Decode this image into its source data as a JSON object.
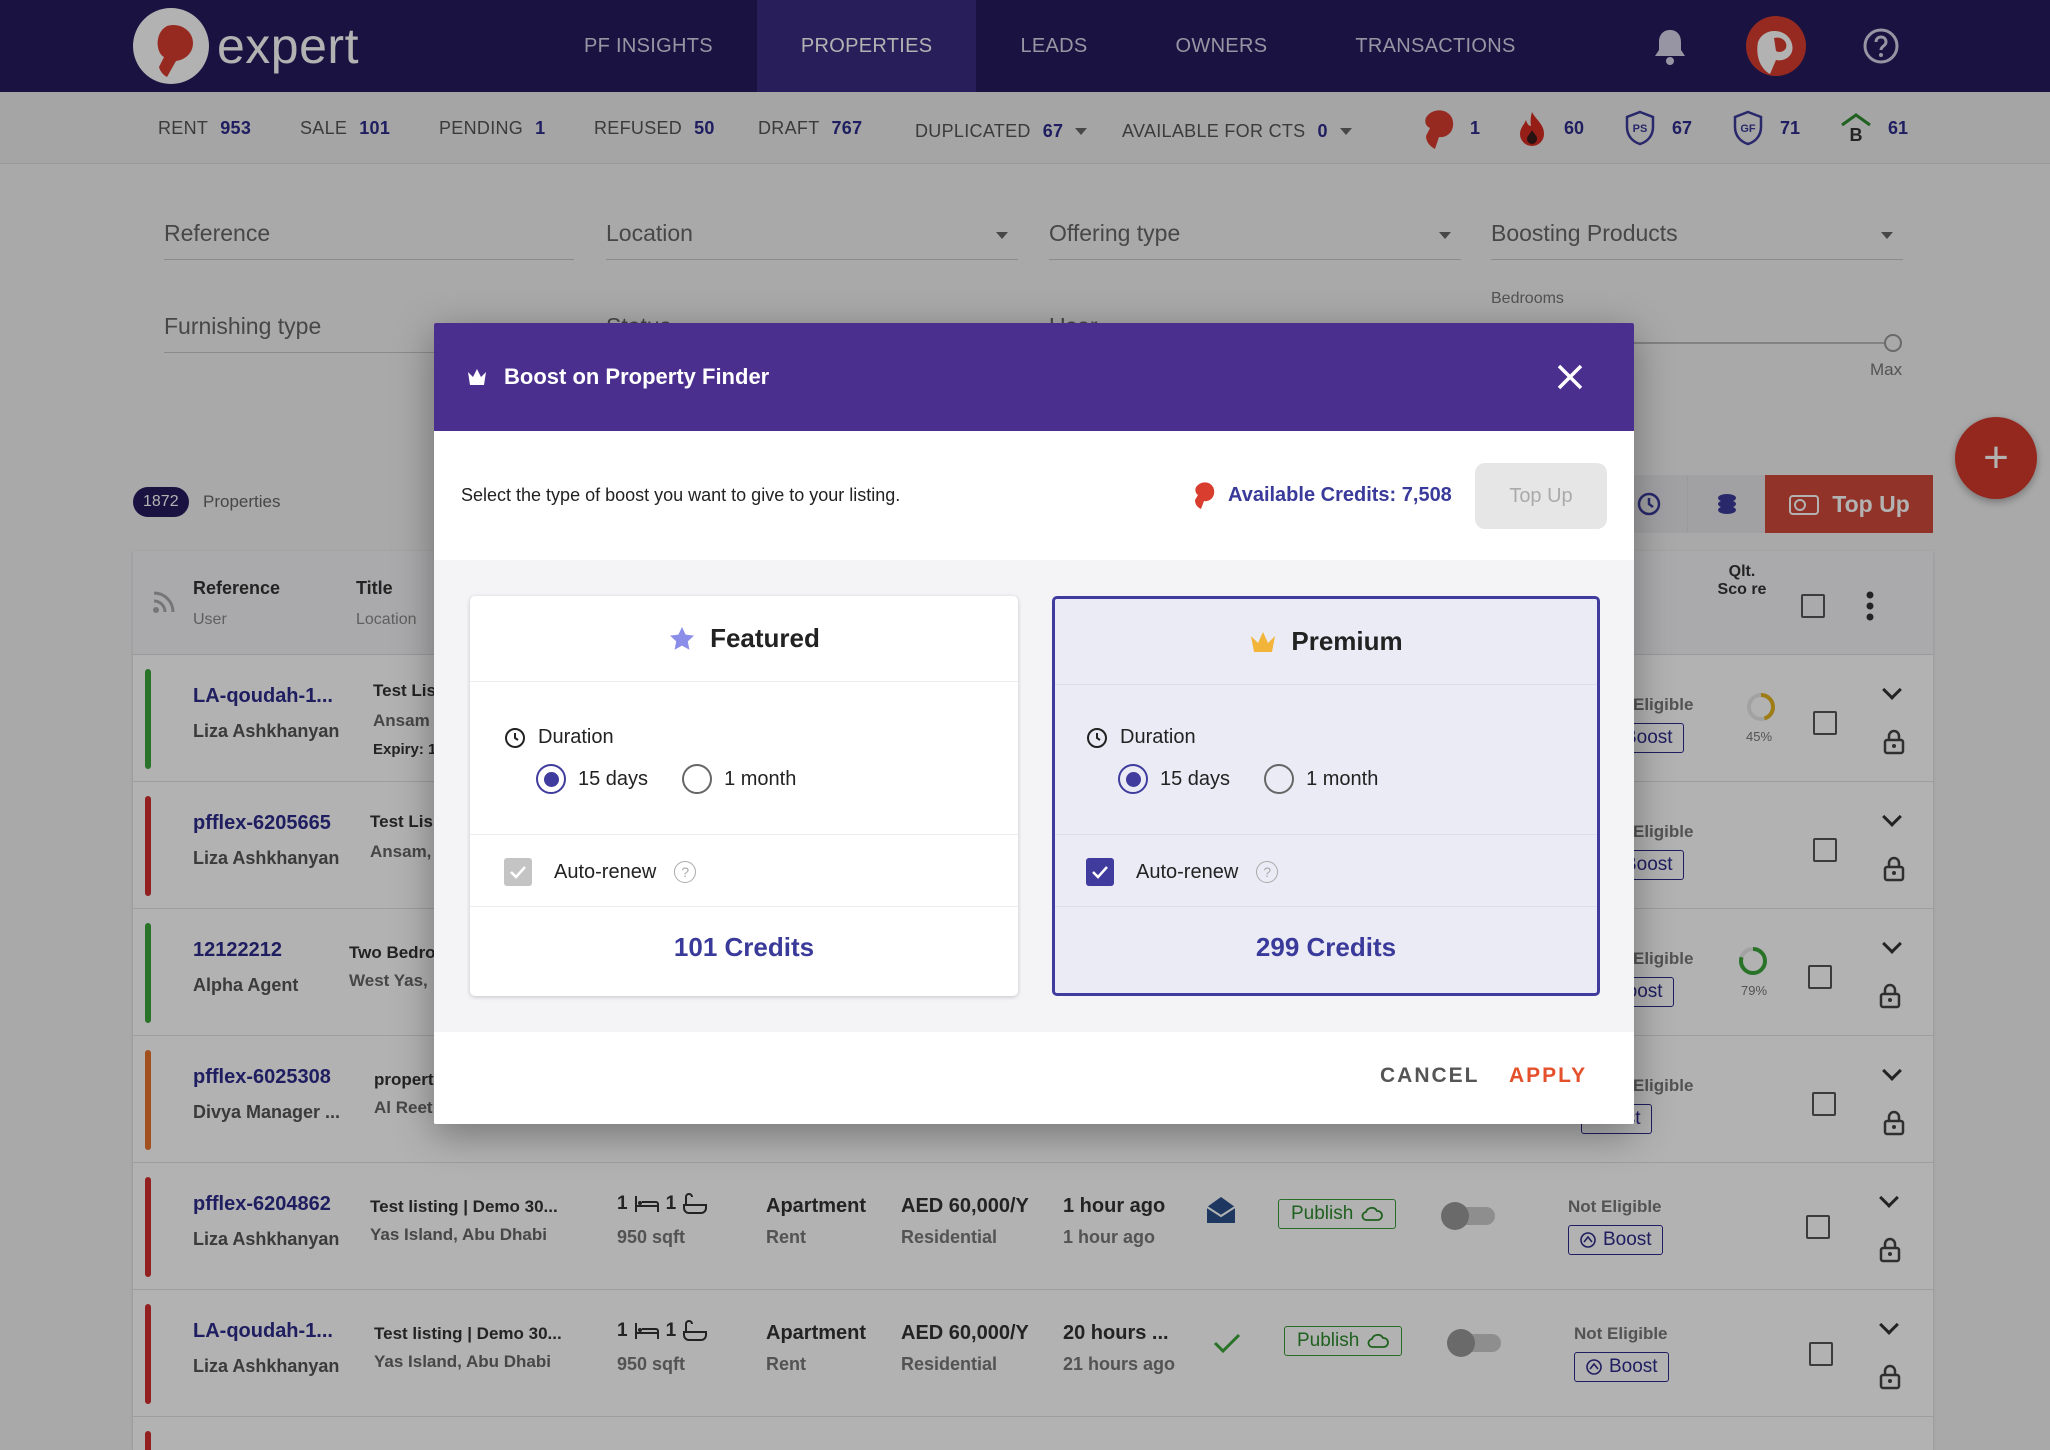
{
  "app": {
    "logo_text": "expert"
  },
  "nav": {
    "items": [
      "PF INSIGHTS",
      "PROPERTIES",
      "LEADS",
      "OWNERS",
      "TRANSACTIONS"
    ],
    "active": "PROPERTIES"
  },
  "stats": {
    "rent_label": "RENT",
    "rent": "953",
    "sale_label": "SALE",
    "sale": "101",
    "pending_label": "PENDING",
    "pending": "1",
    "refused_label": "REFUSED",
    "refused": "50",
    "draft_label": "DRAFT",
    "draft": "767",
    "duplicated_label": "DUPLICATED",
    "duplicated": "67",
    "cts_label": "AVAILABLE FOR CTS",
    "cts": "0",
    "pf": "1",
    "hot": "60",
    "ps": "67",
    "gf": "71",
    "b": "61"
  },
  "filters": {
    "reference": "Reference",
    "location": "Location",
    "offering": "Offering type",
    "boosting": "Boosting Products",
    "furnishing": "Furnishing type",
    "status": "Status",
    "user": "User",
    "bedrooms": "Bedrooms",
    "max": "Max"
  },
  "list": {
    "count": "1872",
    "count_label": "Properties",
    "topup_label": "Top Up"
  },
  "table": {
    "headers": {
      "reference": "Reference",
      "user": "User",
      "title": "Title",
      "location": "Location",
      "qlt": "Qlt. Sco re"
    },
    "rows": [
      {
        "ref": "LA-qoudah-1...",
        "user": "Liza Ashkhanyan",
        "title": "Test Lis",
        "loc": "Ansam",
        "extra": "Expiry: 1",
        "elig": "Eligible",
        "boost": "Boost",
        "score": "45%",
        "color": "#3aa53a"
      },
      {
        "ref": "pfflex-6205665",
        "user": "Liza Ashkhanyan",
        "title": "Test Lis",
        "loc": "Ansam,",
        "elig": "Eligible",
        "boost": "Boost",
        "color": "#d32f2f"
      },
      {
        "ref": "12122212",
        "user": "Alpha Agent",
        "title": "Two Bedro",
        "loc": "West Yas,",
        "elig": "Eligible",
        "boost": "Boost",
        "score": "79%",
        "color": "#3aa53a"
      },
      {
        "ref": "pfflex-6025308",
        "user": "Divya Manager ...",
        "title": "propert",
        "loc": "Al Reet",
        "elig": "Eligible",
        "boost": "Boost",
        "color": "#e8742b"
      },
      {
        "ref": "pfflex-6204862",
        "user": "Liza Ashkhanyan",
        "title": "Test listing | Demo 30...",
        "loc": "Yas Island, Abu Dhabi",
        "beds": "1",
        "baths": "1",
        "size": "950 sqft",
        "type": "Apartment",
        "offering": "Rent",
        "price": "AED 60,000/Y",
        "category": "Residential",
        "updated": "1 hour ago",
        "created": "1 hour ago",
        "publish": "Publish",
        "elig": "Not Eligible",
        "boost": "Boost",
        "color": "#d32f2f"
      },
      {
        "ref": "LA-qoudah-1...",
        "user": "Liza Ashkhanyan",
        "title": "Test listing | Demo 30...",
        "loc": "Yas Island, Abu Dhabi",
        "beds": "1",
        "baths": "1",
        "size": "950 sqft",
        "type": "Apartment",
        "offering": "Rent",
        "price": "AED 60,000/Y",
        "category": "Residential",
        "updated": "20 hours ...",
        "created": "21 hours ago",
        "publish": "Publish",
        "elig": "Not Eligible",
        "boost": "Boost",
        "color": "#d32f2f"
      }
    ]
  },
  "modal": {
    "title": "Boost on Property Finder",
    "subtitle": "Select the type of boost you want to give to your listing.",
    "credits": "Available Credits: 7,508",
    "topup": "Top Up",
    "featured": {
      "title": "Featured",
      "duration": "Duration",
      "opt1": "15 days",
      "opt2": "1 month",
      "renew": "Auto-renew",
      "price": "101 Credits"
    },
    "premium": {
      "title": "Premium",
      "duration": "Duration",
      "opt1": "15 days",
      "opt2": "1 month",
      "renew": "Auto-renew",
      "price": "299 Credits"
    },
    "cancel": "CANCEL",
    "apply": "APPLY"
  },
  "colors": {
    "nav": "#261a5e",
    "modal_header": "#4b2f8f",
    "accent": "#3f3c9e",
    "apply": "#e5502c"
  }
}
